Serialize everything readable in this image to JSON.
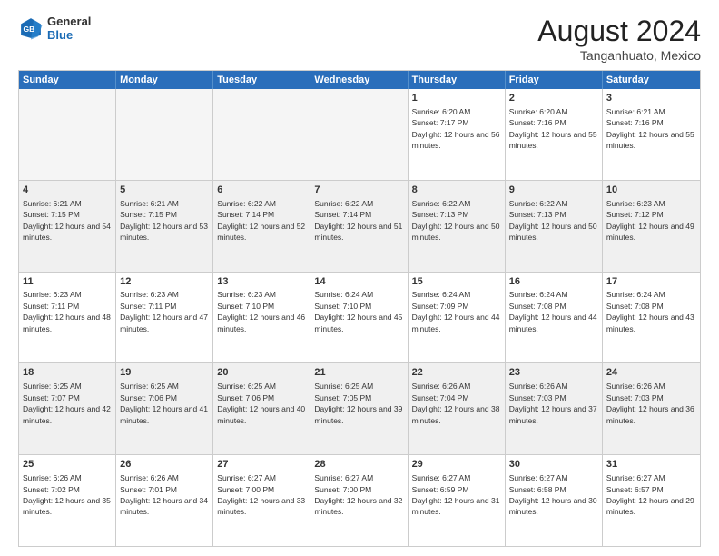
{
  "header": {
    "logo_general": "General",
    "logo_blue": "Blue",
    "month_year": "August 2024",
    "location": "Tanganhuato, Mexico"
  },
  "days_of_week": [
    "Sunday",
    "Monday",
    "Tuesday",
    "Wednesday",
    "Thursday",
    "Friday",
    "Saturday"
  ],
  "rows": [
    [
      {
        "day": "",
        "empty": true
      },
      {
        "day": "",
        "empty": true
      },
      {
        "day": "",
        "empty": true
      },
      {
        "day": "",
        "empty": true
      },
      {
        "day": "1",
        "sunrise": "6:20 AM",
        "sunset": "7:17 PM",
        "daylight": "12 hours and 56 minutes."
      },
      {
        "day": "2",
        "sunrise": "6:20 AM",
        "sunset": "7:16 PM",
        "daylight": "12 hours and 55 minutes."
      },
      {
        "day": "3",
        "sunrise": "6:21 AM",
        "sunset": "7:16 PM",
        "daylight": "12 hours and 55 minutes."
      }
    ],
    [
      {
        "day": "4",
        "sunrise": "6:21 AM",
        "sunset": "7:15 PM",
        "daylight": "12 hours and 54 minutes."
      },
      {
        "day": "5",
        "sunrise": "6:21 AM",
        "sunset": "7:15 PM",
        "daylight": "12 hours and 53 minutes."
      },
      {
        "day": "6",
        "sunrise": "6:22 AM",
        "sunset": "7:14 PM",
        "daylight": "12 hours and 52 minutes."
      },
      {
        "day": "7",
        "sunrise": "6:22 AM",
        "sunset": "7:14 PM",
        "daylight": "12 hours and 51 minutes."
      },
      {
        "day": "8",
        "sunrise": "6:22 AM",
        "sunset": "7:13 PM",
        "daylight": "12 hours and 50 minutes."
      },
      {
        "day": "9",
        "sunrise": "6:22 AM",
        "sunset": "7:13 PM",
        "daylight": "12 hours and 50 minutes."
      },
      {
        "day": "10",
        "sunrise": "6:23 AM",
        "sunset": "7:12 PM",
        "daylight": "12 hours and 49 minutes."
      }
    ],
    [
      {
        "day": "11",
        "sunrise": "6:23 AM",
        "sunset": "7:11 PM",
        "daylight": "12 hours and 48 minutes."
      },
      {
        "day": "12",
        "sunrise": "6:23 AM",
        "sunset": "7:11 PM",
        "daylight": "12 hours and 47 minutes."
      },
      {
        "day": "13",
        "sunrise": "6:23 AM",
        "sunset": "7:10 PM",
        "daylight": "12 hours and 46 minutes."
      },
      {
        "day": "14",
        "sunrise": "6:24 AM",
        "sunset": "7:10 PM",
        "daylight": "12 hours and 45 minutes."
      },
      {
        "day": "15",
        "sunrise": "6:24 AM",
        "sunset": "7:09 PM",
        "daylight": "12 hours and 44 minutes."
      },
      {
        "day": "16",
        "sunrise": "6:24 AM",
        "sunset": "7:08 PM",
        "daylight": "12 hours and 44 minutes."
      },
      {
        "day": "17",
        "sunrise": "6:24 AM",
        "sunset": "7:08 PM",
        "daylight": "12 hours and 43 minutes."
      }
    ],
    [
      {
        "day": "18",
        "sunrise": "6:25 AM",
        "sunset": "7:07 PM",
        "daylight": "12 hours and 42 minutes."
      },
      {
        "day": "19",
        "sunrise": "6:25 AM",
        "sunset": "7:06 PM",
        "daylight": "12 hours and 41 minutes."
      },
      {
        "day": "20",
        "sunrise": "6:25 AM",
        "sunset": "7:06 PM",
        "daylight": "12 hours and 40 minutes."
      },
      {
        "day": "21",
        "sunrise": "6:25 AM",
        "sunset": "7:05 PM",
        "daylight": "12 hours and 39 minutes."
      },
      {
        "day": "22",
        "sunrise": "6:26 AM",
        "sunset": "7:04 PM",
        "daylight": "12 hours and 38 minutes."
      },
      {
        "day": "23",
        "sunrise": "6:26 AM",
        "sunset": "7:03 PM",
        "daylight": "12 hours and 37 minutes."
      },
      {
        "day": "24",
        "sunrise": "6:26 AM",
        "sunset": "7:03 PM",
        "daylight": "12 hours and 36 minutes."
      }
    ],
    [
      {
        "day": "25",
        "sunrise": "6:26 AM",
        "sunset": "7:02 PM",
        "daylight": "12 hours and 35 minutes."
      },
      {
        "day": "26",
        "sunrise": "6:26 AM",
        "sunset": "7:01 PM",
        "daylight": "12 hours and 34 minutes."
      },
      {
        "day": "27",
        "sunrise": "6:27 AM",
        "sunset": "7:00 PM",
        "daylight": "12 hours and 33 minutes."
      },
      {
        "day": "28",
        "sunrise": "6:27 AM",
        "sunset": "7:00 PM",
        "daylight": "12 hours and 32 minutes."
      },
      {
        "day": "29",
        "sunrise": "6:27 AM",
        "sunset": "6:59 PM",
        "daylight": "12 hours and 31 minutes."
      },
      {
        "day": "30",
        "sunrise": "6:27 AM",
        "sunset": "6:58 PM",
        "daylight": "12 hours and 30 minutes."
      },
      {
        "day": "31",
        "sunrise": "6:27 AM",
        "sunset": "6:57 PM",
        "daylight": "12 hours and 29 minutes."
      }
    ]
  ]
}
